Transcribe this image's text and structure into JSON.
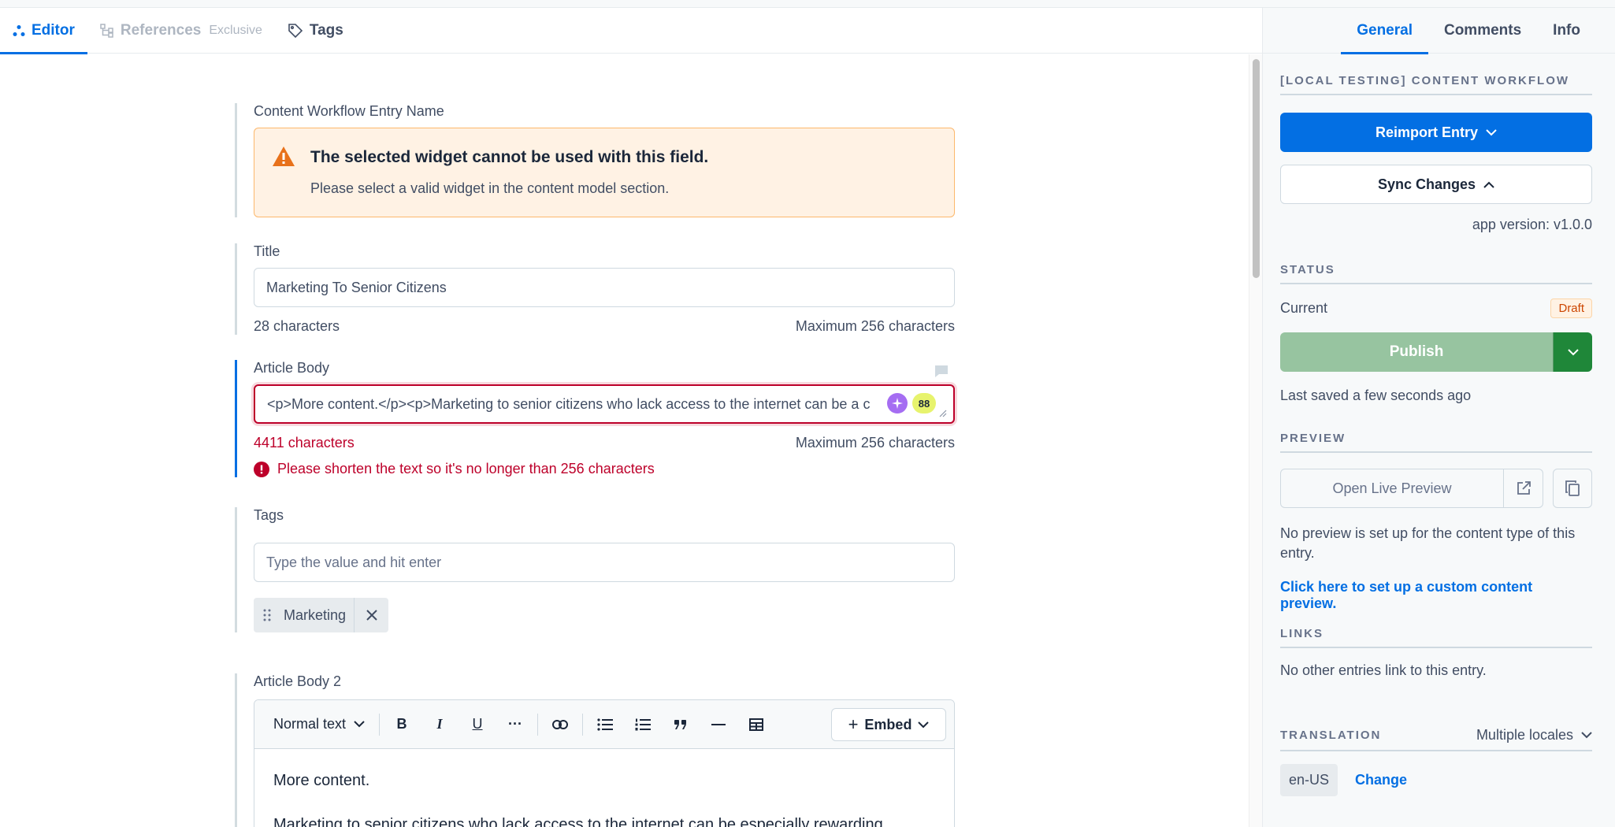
{
  "tabs": {
    "editor": "Editor",
    "references": "References",
    "references_badge": "Exclusive",
    "tags": "Tags"
  },
  "fields": {
    "entry_name": {
      "label": "Content Workflow Entry Name",
      "warning_title": "The selected widget cannot be used with this field.",
      "warning_text": "Please select a valid widget in the content model section."
    },
    "title": {
      "label": "Title",
      "value": "Marketing To Senior Citizens",
      "count": "28 characters",
      "max": "Maximum 256 characters"
    },
    "article_body": {
      "label": "Article Body",
      "value": "<p>More content.</p><p>Marketing to senior citizens who lack access to the internet can be a c",
      "count": "4411 characters",
      "max": "Maximum 256 characters",
      "error": "Please shorten the text so it's no longer than 256 characters",
      "badge_count": "88"
    },
    "tags": {
      "label": "Tags",
      "placeholder": "Type the value and hit enter",
      "chips": [
        "Marketing"
      ]
    },
    "article_body_2": {
      "label": "Article Body 2",
      "format": "Normal text",
      "embed": "Embed",
      "paragraph1": "More content.",
      "paragraph2": "Marketing to senior citizens who lack access to the internet can be especially rewarding"
    }
  },
  "sidebar": {
    "tabs": [
      "General",
      "Comments",
      "Info"
    ],
    "workflow_heading": "[Local Testing] Content Workflow",
    "reimport": "Reimport Entry",
    "sync": "Sync Changes",
    "app_version": "app version: v1.0.0",
    "status_heading": "Status",
    "current_label": "Current",
    "status_badge": "Draft",
    "publish": "Publish",
    "last_saved": "Last saved a few seconds ago",
    "preview_heading": "Preview",
    "open_preview": "Open Live Preview",
    "no_preview": "No preview is set up for the content type of this entry.",
    "preview_link": "Click here to set up a custom content preview.",
    "links_heading": "Links",
    "no_links": "No other entries link to this entry.",
    "translation_heading": "Translation",
    "locales": "Multiple locales",
    "locale": "en-US",
    "change": "Change"
  },
  "colors": {
    "accent": "#036fe3",
    "error": "#bd002a",
    "warning_bg": "#fff2e4",
    "publish": "#97c4a0",
    "publish_dark": "#1f8739"
  }
}
